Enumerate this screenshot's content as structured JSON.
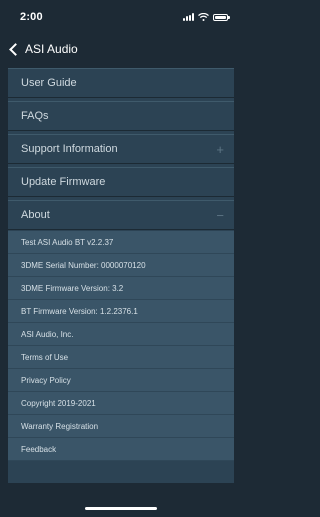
{
  "status_bar": {
    "time": "2:00"
  },
  "nav": {
    "back_title": "ASI Audio"
  },
  "menu": [
    {
      "label": "User Guide",
      "expand": ""
    },
    {
      "label": "FAQs",
      "expand": ""
    },
    {
      "label": "Support Information",
      "expand": "+"
    },
    {
      "label": "Update Firmware",
      "expand": ""
    },
    {
      "label": "About",
      "expand": "−"
    }
  ],
  "about": {
    "items": [
      "Test ASI Audio BT v2.2.37",
      "3DME Serial Number: 0000070120",
      "3DME Firmware Version: 3.2",
      "BT Firmware Version: 1.2.2376.1",
      "ASI Audio, Inc.",
      "Terms of Use",
      "Privacy Policy",
      "Copyright 2019-2021",
      "Warranty Registration",
      "Feedback"
    ]
  },
  "colors": {
    "background": "#1d2a35",
    "panel": "#2c4354",
    "sub_panel": "#3a5568"
  },
  "icons": [
    "signal-icon",
    "wifi-icon",
    "battery-icon",
    "back-chevron-icon",
    "plus-icon",
    "minus-icon"
  ]
}
